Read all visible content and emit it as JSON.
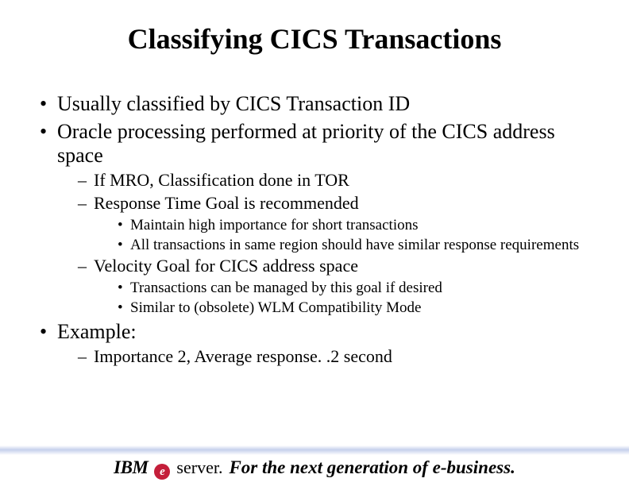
{
  "title": "Classifying CICS Transactions",
  "bullets": {
    "b1": "Usually classified by CICS Transaction ID",
    "b2": "Oracle processing performed at priority of the CICS address space",
    "b2_1": "If MRO, Classification done in TOR",
    "b2_2": "Response Time Goal is recommended",
    "b2_2_1": "Maintain high importance for short transactions",
    "b2_2_2": "All transactions in same region should have similar response requirements",
    "b2_3": "Velocity Goal for CICS address space",
    "b2_3_1": "Transactions can be managed by this goal if desired",
    "b2_3_2": "Similar to (obsolete) WLM Compatibility Mode",
    "b3": "Example:",
    "b3_1": "Importance 2, Average response. .2 second"
  },
  "footer": {
    "ibm": "IBM",
    "e": "e",
    "server": "server.",
    "tagline": "For the next generation of e-business."
  }
}
